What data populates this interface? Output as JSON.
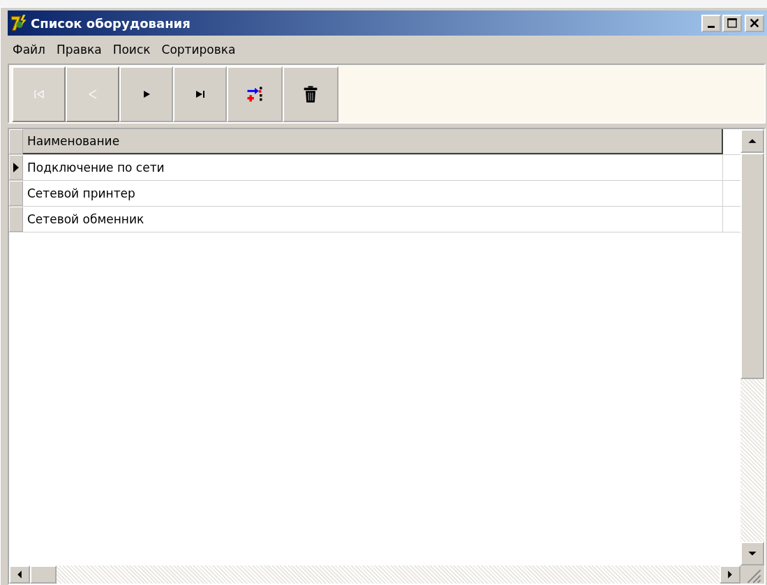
{
  "window": {
    "title": "Список оборудования"
  },
  "menu": [
    "Файл",
    "Правка",
    "Поиск",
    "Сортировка"
  ],
  "toolbar": [
    {
      "kind": "first",
      "disabled": true
    },
    {
      "kind": "prior",
      "disabled": true
    },
    {
      "kind": "next",
      "disabled": false
    },
    {
      "kind": "last",
      "disabled": false
    },
    {
      "kind": "insert",
      "disabled": false
    },
    {
      "kind": "delete",
      "disabled": false
    }
  ],
  "table": {
    "columns": [
      "Наименование"
    ],
    "rows": [
      {
        "name": "Подключение по сети",
        "selected": true
      },
      {
        "name": "Сетевой принтер",
        "selected": false
      },
      {
        "name": "Сетевой обменник",
        "selected": false
      }
    ]
  }
}
